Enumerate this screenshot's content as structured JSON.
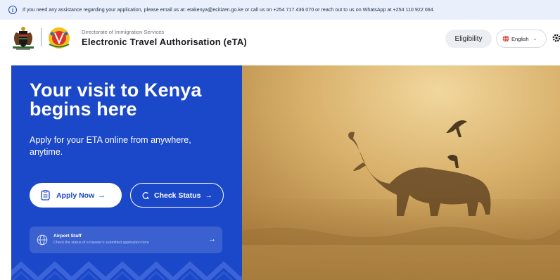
{
  "notice": {
    "icon": "info-icon",
    "text": "If you need any assistance regarding your application, please email us at: etakenya@ecitizen.go.ke or call us on +254 717 436 070 or reach out to us on WhatsApp at +254 110 922 064."
  },
  "header": {
    "subtitle": "Directorate of Immigration Services",
    "title": "Electronic Travel Authorisation (eTA)",
    "eligibility_label": "Eligibility",
    "language_label": "English",
    "language_icon": "globe-icon",
    "settings_icon": "gear-icon"
  },
  "hero": {
    "headline": "Your visit to Kenya begins here",
    "subline": "Apply for your ETA online from anywhere, anytime.",
    "apply_label": "Apply Now",
    "apply_arrow": "→",
    "status_label": "Check Status",
    "status_arrow": "→",
    "airport_title": "Airport Staff",
    "airport_subtitle": "Check the status of a traveler's submitted application here",
    "airport_arrow": "→"
  },
  "colors": {
    "brand_blue": "#1b47c9",
    "notice_bg": "#e9f0fb",
    "hero_photo": "#c9a25f"
  }
}
